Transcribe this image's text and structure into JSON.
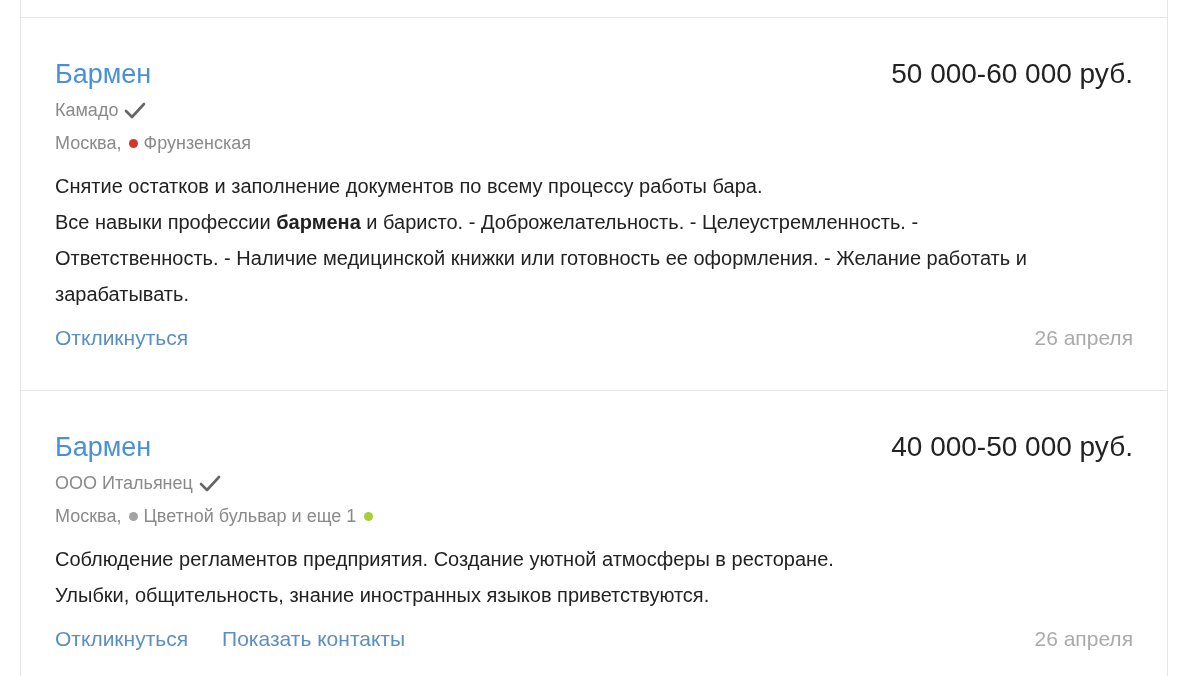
{
  "vacancies": [
    {
      "title": "Бармен",
      "salary": "50 000-60 000 руб.",
      "company": "Камадо",
      "verified": true,
      "city": "Москва,",
      "stations": [
        {
          "name": "Фрунзенская",
          "color": "#d0382b"
        }
      ],
      "description": [
        "Снятие остатков и заполнение документов по всему процессу работы бара.",
        "Все навыки профессии **бармена** и баристо. - Доброжелательность. - Целеустремленность. - Ответственность. - Наличие медицинской книжки или готовность ее оформления. - Желание работать и зарабатывать."
      ],
      "actions": [
        "Откликнуться"
      ],
      "date": "26 апреля"
    },
    {
      "title": "Бармен",
      "salary": "40 000-50 000 руб.",
      "company": "ООО Итальянец",
      "verified": true,
      "city": "Москва,",
      "stations": [
        {
          "name": "Цветной бульвар",
          "color": "#a3a3a3"
        }
      ],
      "more": {
        "text": "и еще 1",
        "color": "#a9cd3c"
      },
      "description": [
        "Соблюдение регламентов предприятия. Создание уютной атмосферы в ресторане.",
        "Улыбки, общительность, знание иностранных языков приветствуются."
      ],
      "actions": [
        "Откликнуться",
        "Показать контакты"
      ],
      "date": "26 апреля"
    }
  ]
}
